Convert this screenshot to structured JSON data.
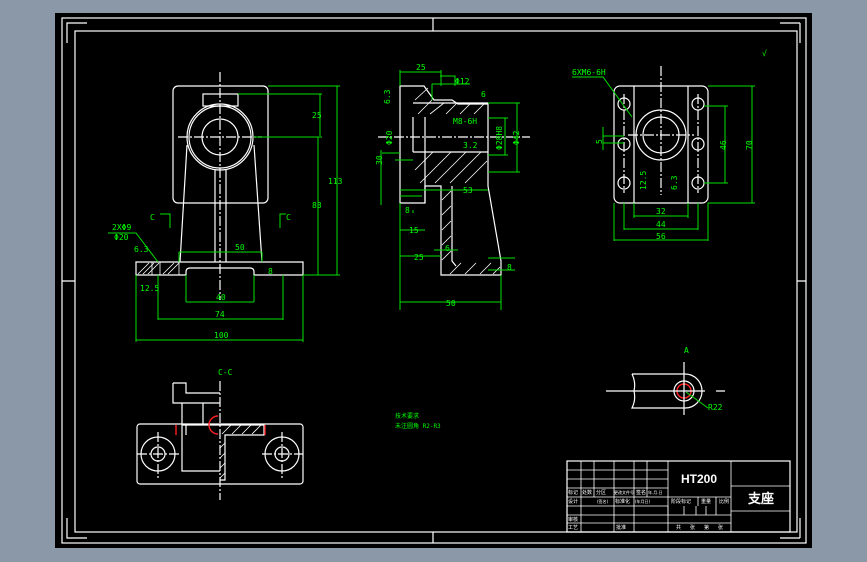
{
  "colors": {
    "background": "#8a98a8",
    "sheet": "#000000",
    "geometry": "#ffffff",
    "dimension": "#00ff00",
    "highlight": "#ff2020"
  },
  "front_view": {
    "dims": {
      "d25": "25",
      "d83": "83",
      "d113": "113",
      "d50": "50",
      "d40": "40",
      "d74": "74",
      "d100": "100",
      "d8": "8"
    },
    "section_mark_left": "C",
    "section_mark_right": "C",
    "hole_note_top": "2XΦ9",
    "hole_note_bottom": "Φ20",
    "roughness_1": "6.3",
    "roughness_2": "12.5"
  },
  "side_view": {
    "dims": {
      "d25": "25",
      "d12": "Φ12",
      "d6top": "6",
      "thread": "M8-6H",
      "d28h8": "Φ28H8",
      "d42": "Φ42",
      "r32": "3.2",
      "d63": "6.3",
      "d30": "30",
      "d20": "Φ20",
      "d53": "53",
      "d8": "8",
      "d15": "15",
      "d25b": "25",
      "d6": "6",
      "d8r": "8",
      "d50": "50"
    }
  },
  "top_view": {
    "thread_note": "6XM6-6H",
    "dims": {
      "d5": "5",
      "d46": "46",
      "d70": "70",
      "d32": "32",
      "d44": "44",
      "d56": "56",
      "r1": "12.5",
      "r2": "6.3"
    }
  },
  "section_cc": {
    "label": "C-C"
  },
  "detail_a": {
    "label": "A",
    "radius": "R22"
  },
  "general_roughness": "√",
  "notes": {
    "title": "技术要求",
    "line1": "未注圆角 R2-R3"
  },
  "title_block": {
    "material": "HT200",
    "part_name": "支座",
    "headers": [
      "标记",
      "处数",
      "分区",
      "更改文件号",
      "签名",
      "年.月.日"
    ],
    "row_design": [
      "设计",
      "标准化"
    ],
    "row_sign": [
      "(签名)",
      "(年月日)"
    ],
    "review": "审核",
    "process": "工艺",
    "approve": "批准",
    "stage_labels": [
      "阶段标记",
      "重量",
      "比例"
    ],
    "sheets": [
      "共",
      "张",
      "第",
      "张"
    ]
  }
}
